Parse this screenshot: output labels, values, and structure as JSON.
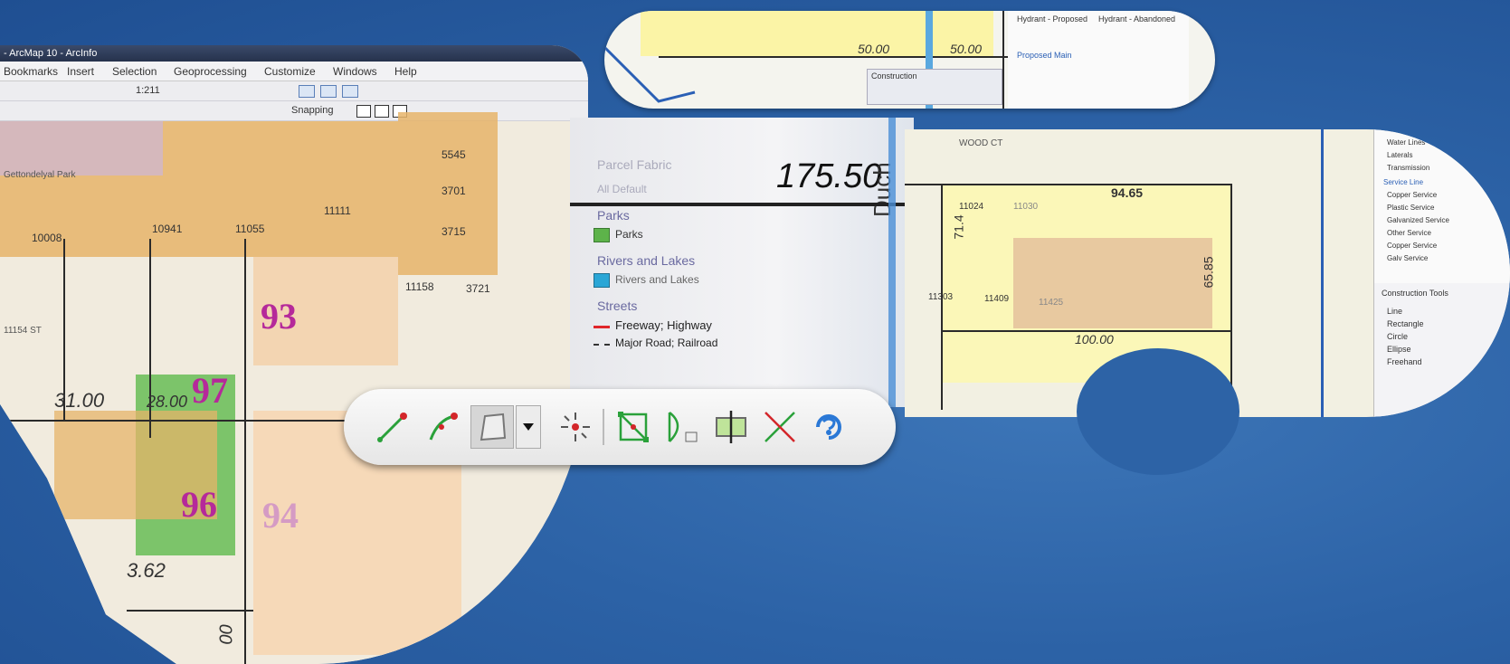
{
  "window": {
    "title": "- ArcMap 10 - ArcInfo"
  },
  "menu": {
    "items": [
      "Bookmarks",
      "Insert",
      "Selection",
      "Geoprocessing",
      "Customize",
      "Windows",
      "Help"
    ]
  },
  "toolbar": {
    "scale": "1:211",
    "snapping_label": "Snapping"
  },
  "left_map": {
    "parcel_numbers": [
      "10008",
      "10941",
      "11055",
      "11111",
      "5545",
      "3701",
      "3715",
      "11158",
      "3721"
    ],
    "label_parcel_name": "Gettondelyal Park",
    "label_street": "11154 ST",
    "lot_labels": [
      "93",
      "97",
      "96",
      "94"
    ],
    "dimensions": [
      "31.00",
      "28.00",
      "3.62",
      "00"
    ]
  },
  "top_pill": {
    "dimensions": [
      "50.00",
      "50.00"
    ],
    "legend_items": [
      "Hydrant - Proposed",
      "Hydrant - Abandoned",
      "Proposed Main"
    ],
    "snip_title": "Construction"
  },
  "legend_panel": {
    "big_dimension": "175.50",
    "road_label": "Duch",
    "faded_header": "Parcel Fabric",
    "faded_item": "All Default",
    "headings": [
      "Parks",
      "Rivers and Lakes",
      "Streets"
    ],
    "items": [
      "Parks",
      "Rivers and Lakes",
      "Freeway; Highway",
      "Major Road; Railroad"
    ]
  },
  "right_map": {
    "dimensions": [
      "94.65",
      "71.4",
      "65.85",
      "100.00"
    ],
    "parcel_numbers": [
      "11024",
      "11030",
      "11303",
      "11409",
      "11425"
    ],
    "street_label": "WOOD CT",
    "legend_items": [
      "Water Lines",
      "Laterals",
      "Transmission",
      "Service Line",
      "Copper Service",
      "Plastic Service",
      "Galvanized Service",
      "Other Service",
      "Copper Service",
      "Galv Service"
    ],
    "construction_tools_title": "Construction Tools",
    "construction_tools": [
      "Line",
      "Rectangle",
      "Circle",
      "Ellipse",
      "Freehand"
    ]
  },
  "colors": {
    "background": "#2c62a6",
    "lot_label": "#b5299a",
    "parcel_tan": "#e6b46a",
    "park_green": "#5db34a",
    "river_blue": "#2aa6d6",
    "freeway_red": "#e0262a",
    "vertex_green": "#2aa13a"
  },
  "edit_tools": [
    "straight-segment-icon",
    "arc-segment-icon",
    "polygon-icon",
    "dropdown-arrow-icon",
    "point-at-end-icon",
    "edit-vertices-icon",
    "reshape-icon",
    "cut-polygon-icon",
    "split-icon",
    "help-icon"
  ]
}
